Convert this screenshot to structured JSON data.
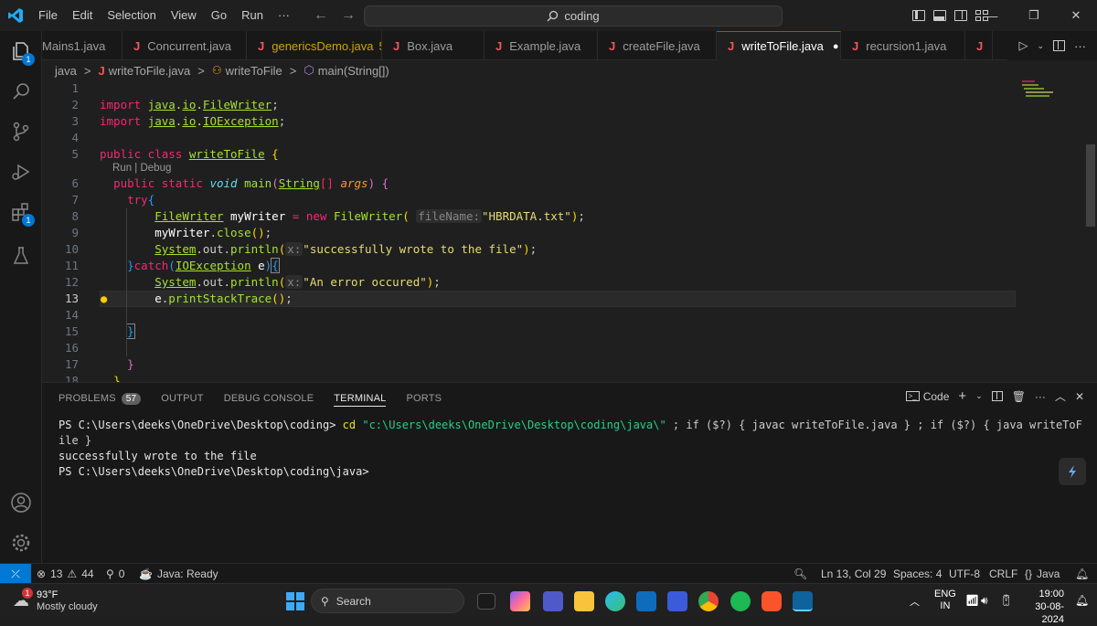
{
  "titlebar": {
    "menu": [
      "File",
      "Edit",
      "Selection",
      "View",
      "Go",
      "Run",
      "···"
    ],
    "search_text": "coding"
  },
  "tabs": [
    {
      "label": "Mains1.java",
      "icon": "J",
      "active": false
    },
    {
      "label": "Concurrent.java",
      "icon": "J",
      "active": false
    },
    {
      "label": "genericsDemo.java",
      "icon": "J",
      "active": false,
      "problems": "5"
    },
    {
      "label": "Box.java",
      "icon": "J",
      "active": false
    },
    {
      "label": "Example.java",
      "icon": "J",
      "active": false
    },
    {
      "label": "createFile.java",
      "icon": "J",
      "active": false
    },
    {
      "label": "writeToFile.java",
      "icon": "J",
      "active": true,
      "dirty": "●"
    },
    {
      "label": "recursion1.java",
      "icon": "J",
      "active": false
    },
    {
      "label": "J",
      "icon": "",
      "active": false
    }
  ],
  "activity_badges": {
    "explorer": "1",
    "extensions": "1"
  },
  "breadcrumb": [
    "java",
    "writeToFile.java",
    "writeToFile",
    "main(String[])"
  ],
  "editor": {
    "codelens": "Run | Debug",
    "current_line": 13,
    "line_numbers": [
      "1",
      "2",
      "3",
      "4",
      "5",
      "6",
      "7",
      "8",
      "9",
      "10",
      "11",
      "12",
      "13",
      "14",
      "15",
      "16",
      "17",
      "18"
    ],
    "hints": {
      "fileName": "fileName:",
      "x": "x:"
    },
    "strings": {
      "hbr": "\"HBRDATA.txt\"",
      "success": "\"successfully wrote to the file\"",
      "error": "\"An error occured\""
    }
  },
  "panel": {
    "tabs": [
      {
        "label": "PROBLEMS",
        "badge": "57"
      },
      {
        "label": "OUTPUT"
      },
      {
        "label": "DEBUG CONSOLE"
      },
      {
        "label": "TERMINAL",
        "active": true
      },
      {
        "label": "PORTS"
      }
    ],
    "terminal_profile": "Code",
    "terminal": {
      "prompt1": "PS C:\\Users\\deeks\\OneDrive\\Desktop\\coding> ",
      "cmd1": "cd ",
      "path1": "\"c:\\Users\\deeks\\OneDrive\\Desktop\\coding\\java\\\"",
      "rest1": " ; if ($?) { javac writeToFile.java } ; if ($?) { java writeToF",
      "line2": "ile }",
      "line3": "successfully wrote to the file",
      "line4": "PS C:\\Users\\deeks\\OneDrive\\Desktop\\coding\\java>"
    }
  },
  "statusbar": {
    "errors": "13",
    "warnings": "44",
    "ports": "0",
    "java": "Java: Ready",
    "position": "Ln 13, Col 29",
    "spaces": "Spaces: 4",
    "encoding": "UTF-8",
    "eol": "CRLF",
    "language": "Java"
  },
  "taskbar": {
    "weather_temp": "93°F",
    "weather_desc": "Mostly cloudy",
    "weather_badge": "1",
    "search": "Search",
    "lang": "ENG",
    "region": "IN",
    "time": "19:00",
    "date": "30-08-2024"
  },
  "colors": {
    "accent": "#0078d4",
    "error_tab_icon": "#f55555"
  }
}
